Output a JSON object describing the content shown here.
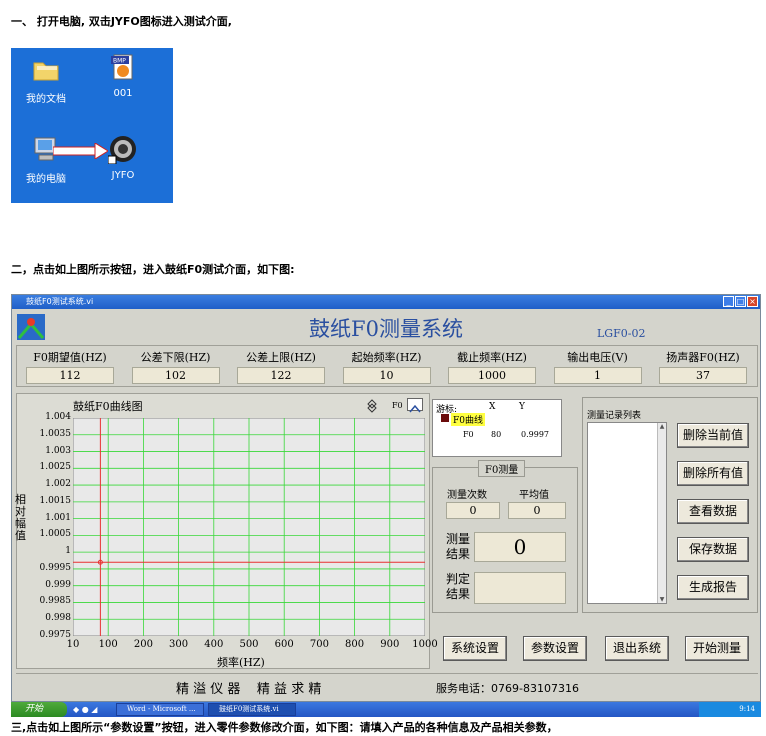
{
  "doc": {
    "step1": "一、   打开电脑, 双击JYFO图标进入测试介面,",
    "step2": "二，点击如上图所示按钮，进入鼓纸F0测试介面，如下图:",
    "step3": "三,点击如上图所示“参数设置”按钮，进入零件参数修改介面，如下图：请填入产品的各种信息及产品相关参数，"
  },
  "desktop": {
    "icons": [
      {
        "label": "我的文档"
      },
      {
        "label": "001",
        "badge": "BMP"
      },
      {
        "label": "我的电脑"
      },
      {
        "label": "JYFO"
      }
    ]
  },
  "window": {
    "title": "鼓纸F0测试系统.vi",
    "app_title": "鼓纸F0测量系统",
    "model": "LGF0-02",
    "params": [
      {
        "label": "F0期望值(HZ)",
        "value": "112"
      },
      {
        "label": "公差下限(HZ)",
        "value": "102"
      },
      {
        "label": "公差上限(HZ)",
        "value": "122"
      },
      {
        "label": "起始频率(HZ)",
        "value": "10"
      },
      {
        "label": "截止频率(HZ)",
        "value": "1000"
      },
      {
        "label": "输出电压(V)",
        "value": "1"
      },
      {
        "label": "扬声器F0(HZ)",
        "value": "37"
      }
    ],
    "chart_title": "鼓纸F0曲线图",
    "f0_label": "F0",
    "cursor": {
      "header": "游标:",
      "x_label": "X",
      "y_label": "Y",
      "curve": "F0曲线",
      "name": "F0",
      "x": "80",
      "y": "0.9997"
    },
    "measure": {
      "title": "F0测量",
      "count_label": "测量次数",
      "avg_label": "平均值",
      "count": "0",
      "avg": "0",
      "result_label": "测量\n结果",
      "result": "0",
      "judge_label": "判定\n结果",
      "judge": ""
    },
    "record_list_label": "测量记录列表",
    "side_buttons": [
      "删除当前值",
      "删除所有值",
      "查看数据",
      "保存数据",
      "生成报告"
    ],
    "bottom_buttons": [
      "系统设置",
      "参数设置",
      "退出系统",
      "开始测量"
    ],
    "footer_left": "精 溢 仪 器    精 益 求 精",
    "footer_right": "服务电话：0769-83107316"
  },
  "taskbar": {
    "start": "开始",
    "tasks": [
      "Word - Microsoft ...",
      "鼓纸F0测试系统.vi"
    ],
    "clock": "9:14"
  },
  "chart_data": {
    "type": "line",
    "xlabel": "频率(HZ)",
    "ylabel": "相对幅值",
    "xlim": [
      10,
      1000
    ],
    "ylim": [
      0.9975,
      1.004
    ],
    "x_ticks": [
      "10",
      "100",
      "200",
      "300",
      "400",
      "500",
      "600",
      "700",
      "800",
      "900",
      "1000"
    ],
    "y_ticks": [
      "1.004",
      "1.0035",
      "1.003",
      "1.0025",
      "1.002",
      "1.0015",
      "1.001",
      "1.0005",
      "1",
      "0.9995",
      "0.999",
      "0.9985",
      "0.998",
      "0.9975"
    ],
    "cursor_x": 80,
    "series": [
      {
        "values": [
          0.9997,
          0.9997
        ]
      }
    ],
    "grid": true
  },
  "colors": {
    "plot_bg": "#e9e9e9",
    "grid": "#38d838",
    "cursor": "#e83030",
    "title": "#2a4fa0"
  }
}
